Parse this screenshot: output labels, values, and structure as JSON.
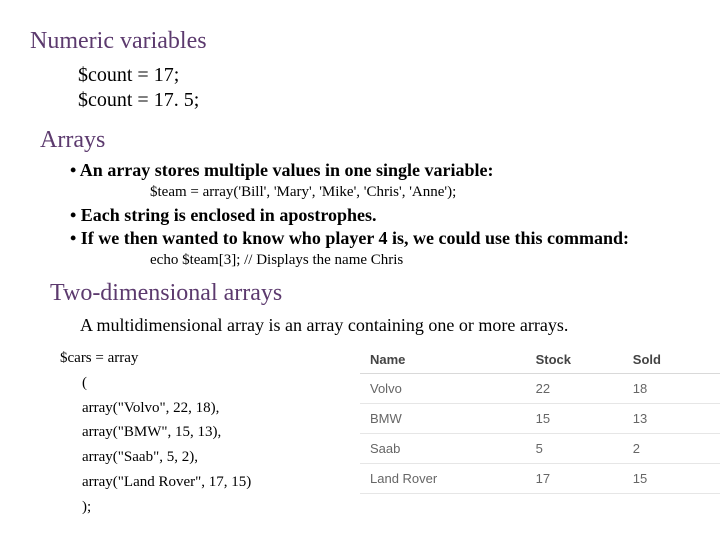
{
  "numeric": {
    "heading": "Numeric variables",
    "line1": "$count = 17;",
    "line2": "$count = 17. 5;"
  },
  "arrays": {
    "heading": "Arrays",
    "b1": "• An array stores multiple values in one single variable:",
    "b1_sub": "$team = array('Bill', 'Mary', 'Mike', 'Chris', 'Anne');",
    "b2": "• Each string is enclosed in apostrophes.",
    "b3": "• If we then wanted to know who player 4 is, we could use this command:",
    "b3_sub": "echo $team[3]; // Displays the name Chris"
  },
  "twod": {
    "heading": "Two-dimensional arrays",
    "para": "A multidimensional array is an array containing one or more arrays.",
    "code": {
      "l1": "$cars = array",
      "l2": "(",
      "l3": "array(\"Volvo\", 22, 18),",
      "l4": "array(\"BMW\", 15, 13),",
      "l5": "array(\"Saab\", 5, 2),",
      "l6": "array(\"Land Rover\", 17, 15)",
      "l7": ");"
    }
  },
  "table": {
    "headers": {
      "c1": "Name",
      "c2": "Stock",
      "c3": "Sold"
    },
    "rows": [
      {
        "c1": "Volvo",
        "c2": "22",
        "c3": "18"
      },
      {
        "c1": "BMW",
        "c2": "15",
        "c3": "13"
      },
      {
        "c1": "Saab",
        "c2": "5",
        "c3": "2"
      },
      {
        "c1": "Land Rover",
        "c2": "17",
        "c3": "15"
      }
    ]
  }
}
